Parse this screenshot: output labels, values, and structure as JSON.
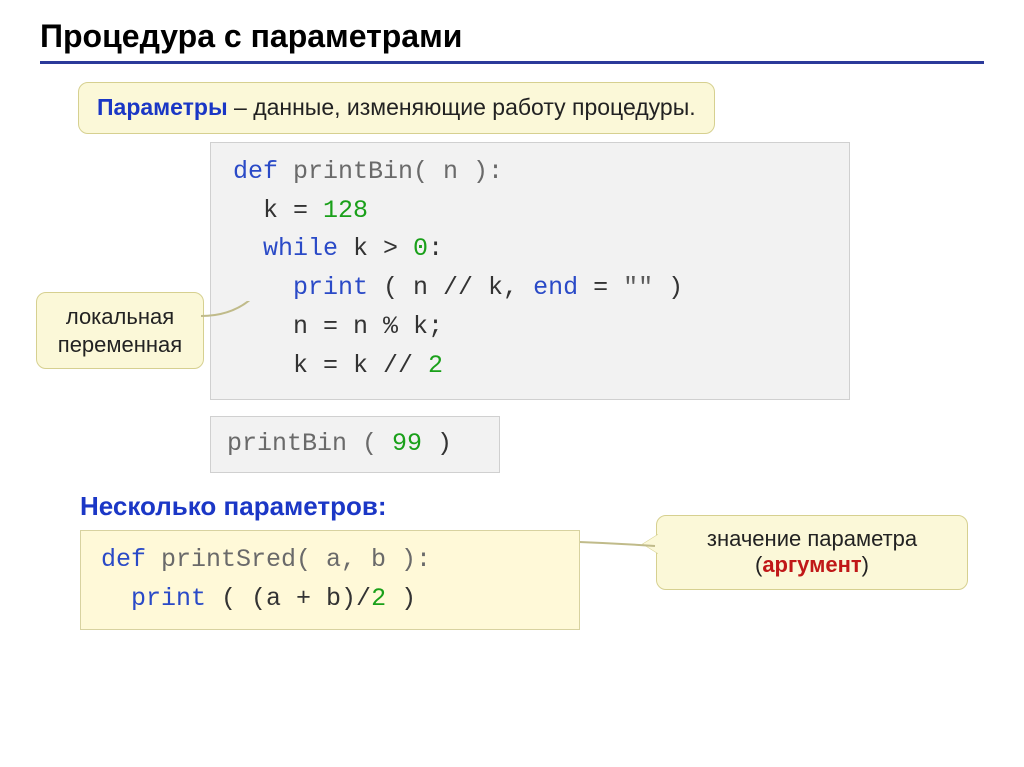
{
  "title": "Процедура с параметрами",
  "callout_top": {
    "term": "Параметры",
    "rest": " – данные, изменяющие работу процедуры."
  },
  "side_callout": {
    "line1": "локальная",
    "line2": "переменная"
  },
  "code_main": {
    "l1_def": "def",
    "l1_name": " printBin( n ):",
    "l2a": "  k = ",
    "l2b": "128",
    "l3a": "  ",
    "l3_kw": "while",
    "l3b": " k > ",
    "l3c": "0",
    "l3d": ":",
    "l4a": "    ",
    "l4_kw": "print",
    "l4b": " ( n // k, ",
    "l4_kw2": "end",
    "l4c": " = ",
    "l4d": "\"\"",
    "l4e": " )",
    "l5": "    n = n % k;",
    "l6a": "    k = k // ",
    "l6b": "2"
  },
  "call_line": {
    "name": "printBin ( ",
    "arg": "99",
    "close": " )"
  },
  "arg_callout": {
    "line1": "значение параметра",
    "line2a": "(",
    "line2b": "аргумент",
    "line2c": ")"
  },
  "subsection": "Несколько параметров:",
  "code_multi": {
    "l1_def": "def",
    "l1_name": " printSred( a, b ):",
    "l2a": "  ",
    "l2_kw": "print",
    "l2b": " ( (a + b)/",
    "l2c": "2",
    "l2d": " )"
  }
}
